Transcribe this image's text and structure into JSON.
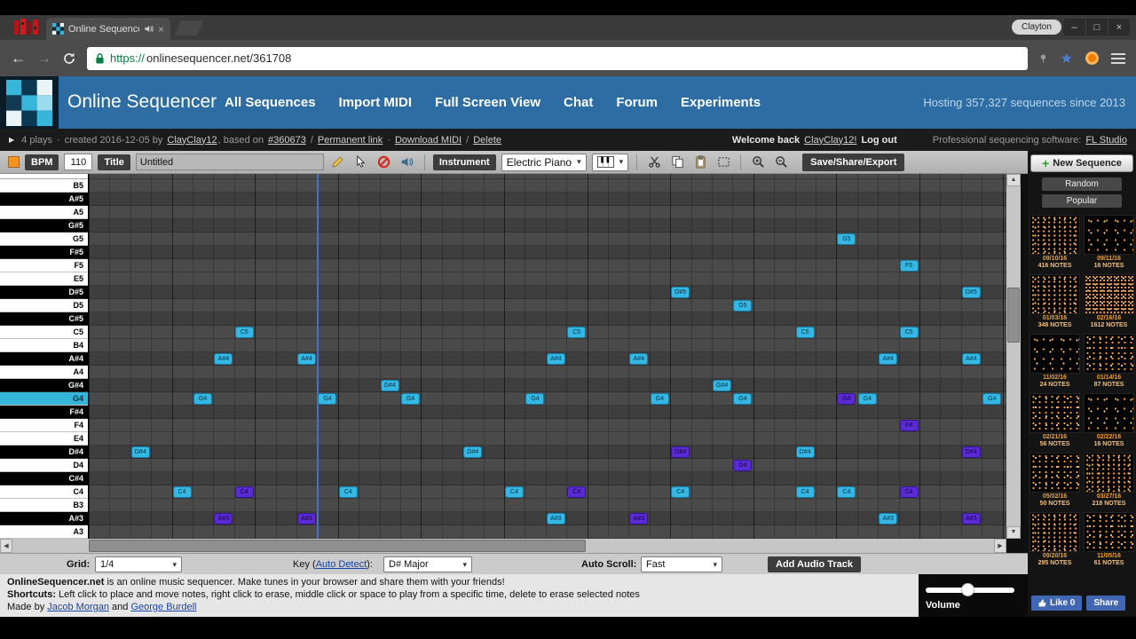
{
  "icons": {
    "back_arrow": "←",
    "forward_arrow": "→",
    "close": "×",
    "minimize": "–",
    "maximize": "□",
    "star": "★",
    "chevron_down": "▾",
    "plus": "+",
    "breadcrumb_arrow": "▶",
    "scroll_up": "▲",
    "scroll_down": "▼",
    "scroll_left": "◀",
    "scroll_right": "▶"
  },
  "browser": {
    "tab_title": "Online Sequencer - Seq",
    "profile": "Clayton",
    "url_scheme": "https://",
    "url_host": "onlinesequencer.net/361708"
  },
  "header": {
    "brand": "Online Sequencer",
    "nav": [
      "All Sequences",
      "Import MIDI",
      "Full Screen View",
      "Chat",
      "Forum",
      "Experiments"
    ],
    "hosting": "Hosting 357,327 sequences since 2013"
  },
  "infobar": {
    "plays": "4 plays",
    "sep_dot": "·",
    "sep_slash": "/",
    "created": "created 2016-12-05 by",
    "author": "ClayClay12",
    "based_on": ", based on",
    "based_on_link": "#360673",
    "permanent_link": "Permanent link",
    "download_midi": "Download MIDI",
    "delete_link": "Delete",
    "welcome": "Welcome back",
    "welcome_user": "ClayClay12!",
    "logout": "Log out",
    "software_label": "Professional sequencing software:",
    "software_link": "FL Studio"
  },
  "toolbar": {
    "bpm_label": "BPM",
    "bpm_value": "110",
    "title_label": "Title",
    "title_value": "Untitled",
    "instrument_label": "Instrument",
    "instrument_value": "Electric Piano",
    "save_button": "Save/Share/Export"
  },
  "piano_roll": {
    "rows": [
      "B5",
      "A#5",
      "A5",
      "G#5",
      "G5",
      "F#5",
      "F5",
      "E5",
      "D#5",
      "D5",
      "C#5",
      "C5",
      "B4",
      "A#4",
      "A4",
      "G#4",
      "G4",
      "F#4",
      "F4",
      "E4",
      "D#4",
      "D4",
      "C#4",
      "C4",
      "B3",
      "A#3",
      "A3"
    ],
    "highlighted_key": "G4",
    "playhead_col": 11,
    "notes": [
      {
        "p": "G5",
        "c": 36,
        "k": "cyan"
      },
      {
        "p": "F5",
        "c": 39,
        "k": "cyan"
      },
      {
        "p": "D#5",
        "c": 28,
        "k": "cyan"
      },
      {
        "p": "D#5",
        "c": 42,
        "k": "cyan"
      },
      {
        "p": "D5",
        "c": 31,
        "k": "cyan"
      },
      {
        "p": "C5",
        "c": 7,
        "k": "cyan"
      },
      {
        "p": "C5",
        "c": 23,
        "k": "cyan"
      },
      {
        "p": "C5",
        "c": 34,
        "k": "cyan"
      },
      {
        "p": "C5",
        "c": 39,
        "k": "cyan"
      },
      {
        "p": "A#4",
        "c": 6,
        "k": "cyan"
      },
      {
        "p": "A#4",
        "c": 10,
        "k": "cyan"
      },
      {
        "p": "A#4",
        "c": 22,
        "k": "cyan"
      },
      {
        "p": "A#4",
        "c": 26,
        "k": "cyan"
      },
      {
        "p": "A#4",
        "c": 38,
        "k": "cyan"
      },
      {
        "p": "A#4",
        "c": 42,
        "k": "cyan"
      },
      {
        "p": "G#4",
        "c": 14,
        "k": "cyan"
      },
      {
        "p": "G#4",
        "c": 30,
        "k": "cyan"
      },
      {
        "p": "G4",
        "c": 5,
        "k": "cyan"
      },
      {
        "p": "G4",
        "c": 11,
        "k": "cyan"
      },
      {
        "p": "G4",
        "c": 15,
        "k": "cyan"
      },
      {
        "p": "G4",
        "c": 21,
        "k": "cyan"
      },
      {
        "p": "G4",
        "c": 27,
        "k": "cyan"
      },
      {
        "p": "G4",
        "c": 31,
        "k": "cyan"
      },
      {
        "p": "G4",
        "c": 36,
        "k": "purple"
      },
      {
        "p": "G4",
        "c": 37,
        "k": "cyan"
      },
      {
        "p": "G4",
        "c": 43,
        "k": "cyan"
      },
      {
        "p": "F4",
        "c": 39,
        "k": "purple"
      },
      {
        "p": "D#4",
        "c": 2,
        "k": "cyan"
      },
      {
        "p": "D#4",
        "c": 18,
        "k": "cyan"
      },
      {
        "p": "D#4",
        "c": 28,
        "k": "purple"
      },
      {
        "p": "D#4",
        "c": 34,
        "k": "cyan"
      },
      {
        "p": "D#4",
        "c": 42,
        "k": "purple"
      },
      {
        "p": "D4",
        "c": 31,
        "k": "purple"
      },
      {
        "p": "C4",
        "c": 4,
        "k": "cyan"
      },
      {
        "p": "C4",
        "c": 7,
        "k": "purple"
      },
      {
        "p": "C4",
        "c": 12,
        "k": "cyan"
      },
      {
        "p": "C4",
        "c": 20,
        "k": "cyan"
      },
      {
        "p": "C4",
        "c": 23,
        "k": "purple"
      },
      {
        "p": "C4",
        "c": 28,
        "k": "cyan"
      },
      {
        "p": "C4",
        "c": 34,
        "k": "cyan"
      },
      {
        "p": "C4",
        "c": 36,
        "k": "cyan"
      },
      {
        "p": "C4",
        "c": 39,
        "k": "purple"
      },
      {
        "p": "A#3",
        "c": 6,
        "k": "purple"
      },
      {
        "p": "A#3",
        "c": 10,
        "k": "purple"
      },
      {
        "p": "A#3",
        "c": 22,
        "k": "cyan"
      },
      {
        "p": "A#3",
        "c": 26,
        "k": "purple"
      },
      {
        "p": "A#3",
        "c": 38,
        "k": "cyan"
      },
      {
        "p": "A#3",
        "c": 42,
        "k": "purple"
      }
    ]
  },
  "sidebar": {
    "new_sequence": "New Sequence",
    "random": "Random",
    "popular": "Popular",
    "thumbnails": [
      {
        "date": "09/10/16",
        "notes": "416 NOTES"
      },
      {
        "date": "09/11/16",
        "notes": "16 NOTES"
      },
      {
        "date": "01/03/16",
        "notes": "348 NOTES"
      },
      {
        "date": "02/16/16",
        "notes": "1612 NOTES"
      },
      {
        "date": "11/02/16",
        "notes": "24 NOTES"
      },
      {
        "date": "01/14/16",
        "notes": "87 NOTES"
      },
      {
        "date": "02/21/16",
        "notes": "56 NOTES"
      },
      {
        "date": "02/22/16",
        "notes": "16 NOTES"
      },
      {
        "date": "05/02/16",
        "notes": "50 NOTES"
      },
      {
        "date": "03/27/16",
        "notes": "218 NOTES"
      },
      {
        "date": "09/20/16",
        "notes": "295 NOTES"
      },
      {
        "date": "11/05/16",
        "notes": "61 NOTES"
      }
    ]
  },
  "bottom_bar": {
    "grid_label": "Grid:",
    "grid_value": "1/4",
    "key_pre": "Key (",
    "key_link": "Auto Detect",
    "key_post": "):",
    "key_value": "D# Major",
    "autoscroll_label": "Auto Scroll:",
    "autoscroll_value": "Fast",
    "add_audio_track": "Add Audio Track"
  },
  "footer": {
    "line1_bold": "OnlineSequencer.net",
    "line1_rest": " is an online music sequencer. Make tunes in your browser and share them with your friends!",
    "line2_bold": "Shortcuts:",
    "line2_rest": " Left click to place and move notes, right click to erase, middle click or space to play from a specific time, delete to erase selected notes",
    "made_by": "Made by",
    "made_link1": "Jacob Morgan",
    "made_and": "and",
    "made_link2": "George Burdell",
    "volume_label": "Volume",
    "like_button": "Like 0",
    "share_button": "Share"
  }
}
